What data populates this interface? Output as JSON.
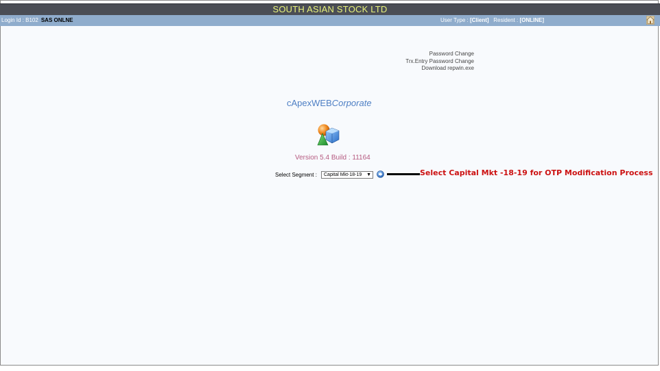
{
  "header": {
    "title": "SOUTH ASIAN STOCK LTD"
  },
  "infobar": {
    "login_prefix": "Login Id : B102",
    "login_name": "SAS ONLNE",
    "user_type_label": "User Type : ",
    "user_type_value": "[Client]",
    "resident_label": "Resident : ",
    "resident_value": "[ONLINE]",
    "home_icon": "home-icon"
  },
  "links": [
    "Password Change",
    "Trx.Entry Password Change",
    "Download repwin.exe"
  ],
  "brand": {
    "main": "cApexWEB",
    "italic": "Corporate",
    "logo_icon": "capex-logo-icon"
  },
  "version": "Version 5.4 Build : 11164",
  "segment": {
    "label": "Select Segment :",
    "selected": "Capital Mkt-18-19",
    "go_icon": "go-arrow-icon"
  },
  "annotation": "Select Capital Mkt -18-19 for OTP Modification Process",
  "colors": {
    "titlebar_bg": "#4a4d55",
    "title_text": "#e8f27a",
    "infobar_bg": "#8faccc",
    "brand_blue": "#4e7fc4",
    "version_text": "#b55a80",
    "annotation_red": "#cc1111"
  }
}
